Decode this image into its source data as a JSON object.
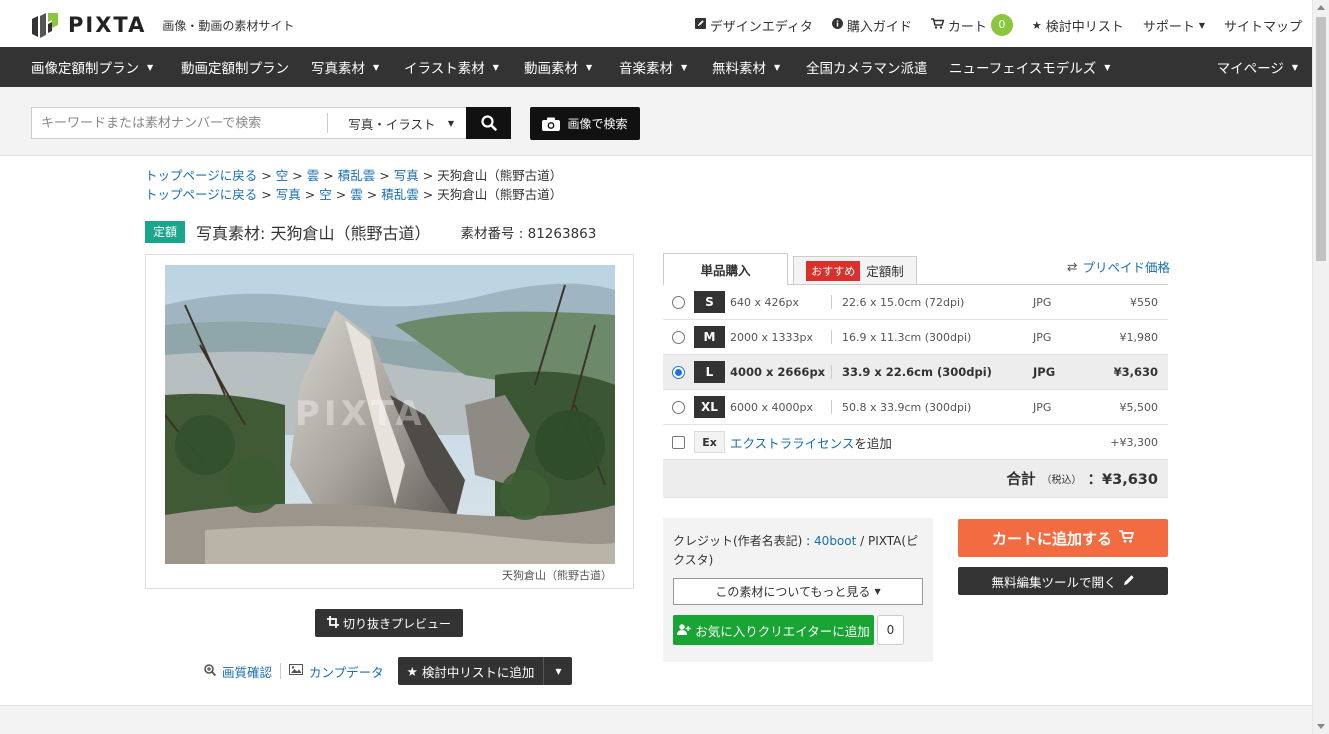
{
  "header": {
    "logo_text": "PIXTA",
    "tagline": "画像・動画の素材サイト",
    "links": [
      {
        "label": "デザインエディタ"
      },
      {
        "label": "購入ガイド"
      },
      {
        "label": "カート",
        "count": "0"
      },
      {
        "label": "検討中リスト"
      },
      {
        "label": "サポート"
      },
      {
        "label": "サイトマップ"
      }
    ]
  },
  "nav": {
    "items": [
      {
        "label": "画像定額制プラン"
      },
      {
        "label": "動画定額制プラン"
      },
      {
        "label": "写真素材"
      },
      {
        "label": "イラスト素材"
      },
      {
        "label": "動画素材"
      },
      {
        "label": "音楽素材"
      },
      {
        "label": "無料素材"
      },
      {
        "label": "全国カメラマン派遣"
      },
      {
        "label": "ニューフェイスモデルズ"
      }
    ],
    "mypage": "マイページ"
  },
  "search": {
    "placeholder": "キーワードまたは素材ナンバーで検索",
    "type_selected": "写真・イラスト",
    "image_search_label": "画像で検索"
  },
  "breadcrumbs": [
    [
      "トップページに戻る",
      "空",
      "雲",
      "積乱雲",
      "写真",
      "天狗倉山（熊野古道）"
    ],
    [
      "トップページに戻る",
      "写真",
      "空",
      "雲",
      "積乱雲",
      "天狗倉山（熊野古道）"
    ]
  ],
  "item": {
    "badge": "定額",
    "title": "写真素材: 天狗倉山（熊野古道）",
    "number": "素材番号 : 81263863",
    "caption": "天狗倉山（熊野古道）",
    "watermark": "PIXTA"
  },
  "actions": {
    "crop_preview": "切り抜きプレビュー",
    "quality": "画質確認",
    "comp": "カンプデータ",
    "wishlist": "検討中リストに追加"
  },
  "purchase": {
    "tab_single": "単品購入",
    "tab_recommend_badge": "おすすめ",
    "tab_subscription": "定額制",
    "prepaid": "プリペイド価格",
    "sizes": [
      {
        "code": "S",
        "px": "640 x 426px",
        "cm": "22.6 x 15.0cm (72dpi)",
        "format": "JPG",
        "price": "¥550",
        "selected": false
      },
      {
        "code": "M",
        "px": "2000 x 1333px",
        "cm": "16.9 x 11.3cm (300dpi)",
        "format": "JPG",
        "price": "¥1,980",
        "selected": false
      },
      {
        "code": "L",
        "px": "4000 x 2666px",
        "cm": "33.9 x 22.6cm (300dpi)",
        "format": "JPG",
        "price": "¥3,630",
        "selected": true
      },
      {
        "code": "XL",
        "px": "6000 x 4000px",
        "cm": "50.8 x 33.9cm (300dpi)",
        "format": "JPG",
        "price": "¥5,500",
        "selected": false
      }
    ],
    "extra": {
      "code": "Ex",
      "link": "エクストラライセンス",
      "suffix": "を追加",
      "price": "+¥3,300"
    },
    "total_label": "合計",
    "total_tax": "（税込）",
    "total_value": "：¥3,630"
  },
  "credit": {
    "prefix": "クレジット(作者名表記) : ",
    "author": "40boot",
    "suffix": " / PIXTA(ピクスタ)",
    "more": "この素材についてもっと見る",
    "fav_label": "お気に入りクリエイターに追加",
    "fav_count": "0"
  },
  "buttons": {
    "add_to_cart": "カートに追加する",
    "free_edit": "無料編集ツールで開く"
  },
  "colors": {
    "accent_green": "#1aa58d",
    "cart_orange": "#f26b41",
    "fav_green": "#19a533",
    "link_blue": "#1a6fb0",
    "nav_dark": "#333333"
  }
}
